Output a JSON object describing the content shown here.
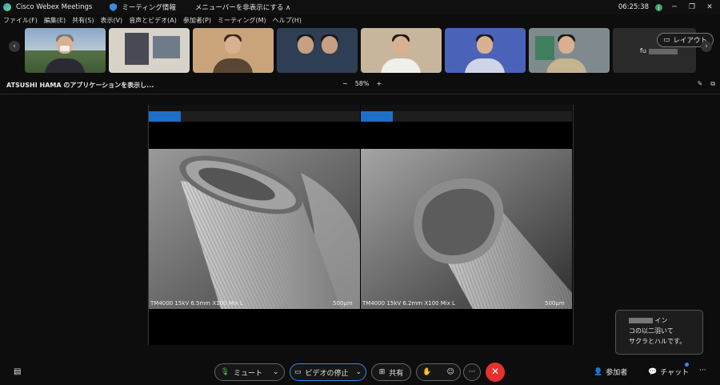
{
  "titlebar": {
    "app_name": "Cisco Webex Meetings",
    "meeting_info": "ミーティング情報",
    "hide_menu": "メニューバーを非表示にする ∧",
    "clock": "06:25:38",
    "avatar_initial": "J"
  },
  "menu": {
    "items": [
      "ファイル(F)",
      "編集(E)",
      "共有(S)",
      "表示(V)",
      "音声とビデオ(A)",
      "参加者(P)",
      "ミーティング(M)",
      "ヘルプ(H)"
    ]
  },
  "strip": {
    "last_tile_name": "fu",
    "layout_label": "レイアウト"
  },
  "share": {
    "title": "ATSUSHI HAMA のアプリケーションを表示し...",
    "zoom_minus": "−",
    "zoom_level": "58%",
    "zoom_plus": "+"
  },
  "panes": [
    {
      "caption_left": "TM4000 15kV 6.5mm X100 Mix L",
      "caption_right": "500μm"
    },
    {
      "caption_left": "TM4000 15kV 6.2mm X100 Mix L",
      "caption_right": "500μm"
    }
  ],
  "controls": {
    "mute": "ミュート",
    "stop_video": "ビデオの停止",
    "share": "共有",
    "participants": "参加者",
    "chat": "チャット",
    "more": "···"
  },
  "chat_popup": {
    "line1_suffix": "イン",
    "line2": "コの以二羽いて",
    "line3": "サクラとハルです。"
  },
  "colors": {
    "end_call": "#e5302e",
    "accent": "#1f6fc8",
    "mute_mic": "#4cc35a"
  }
}
